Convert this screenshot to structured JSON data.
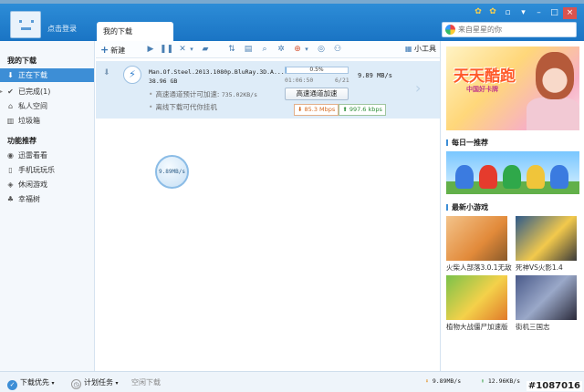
{
  "app": {
    "login_label": "点击登录",
    "active_tab": "我的下载",
    "window_controls": {
      "minimize": "–",
      "maximize": "□",
      "close": "×",
      "menu": "▾",
      "skin": "▫"
    }
  },
  "search": {
    "placeholder": "来自星星的你"
  },
  "sidebar": {
    "section1": "我的下载",
    "items": [
      {
        "label": "正在下载",
        "icon": "download-icon",
        "glyph": "⬇"
      },
      {
        "label": "已完成(1)",
        "icon": "check-icon",
        "glyph": "✔"
      },
      {
        "label": "私人空间",
        "icon": "lock-icon",
        "glyph": "⌂"
      },
      {
        "label": "垃圾箱",
        "icon": "trash-icon",
        "glyph": "▥"
      }
    ],
    "section2": "功能推荐",
    "features": [
      {
        "label": "迅雷看看",
        "icon": "play-icon",
        "glyph": "◉"
      },
      {
        "label": "手机玩玩乐",
        "icon": "phone-icon",
        "glyph": "▯"
      },
      {
        "label": "休闲游戏",
        "icon": "gamepad-icon",
        "glyph": "◈"
      },
      {
        "label": "幸福树",
        "icon": "tree-icon",
        "glyph": "♣"
      }
    ]
  },
  "toolbar": {
    "new_label": "新建",
    "new_glyph": "+",
    "buttons": [
      "▶",
      "❚❚",
      "✕",
      "▾",
      "▰",
      "⇅",
      "▤",
      "⌕",
      "✲",
      "⊕",
      "▾",
      "◎",
      "⚇"
    ],
    "tools_label": "小工具",
    "tools_glyph": "▦"
  },
  "task": {
    "filename": "Man.Of.Steel.2013.1080p.BluRay.3D.A...",
    "size": "38.96 GB",
    "progress_fraction": 0.005,
    "progress_label": "0.5%",
    "time_left": "01:06:50",
    "parts": "6/21",
    "speed": "9.89  MB/s",
    "hs_line1_label": "高速通道预计可加速: ",
    "hs_line1_rate": "735.02KB/s",
    "hs_line2_label": "离线下载可代你挂机",
    "accel_button": "高速通道加速",
    "up_rate": "85.3 Mbps",
    "down_rate": "997.6 kbps"
  },
  "bubble": {
    "speed": "9.89MB/s"
  },
  "right_panel": {
    "ad_title": "天天酷跑",
    "ad_sub": "中国好卡牌",
    "daily_title": "每日一推荐",
    "games_title": "最新小游戏",
    "games": [
      {
        "name": "火柴人部落3.0.1无敌"
      },
      {
        "name": "死神VS火影1.4"
      },
      {
        "name": "植物大战僵尸加速版"
      },
      {
        "name": "街机三国志"
      }
    ]
  },
  "statusbar": {
    "download_first": "下载优先",
    "scheduled": "计划任务",
    "idle_download": "空闲下载",
    "down_speed": "9.89MB/s",
    "up_speed": "12.96KB/s"
  },
  "watermark": "#1087016"
}
